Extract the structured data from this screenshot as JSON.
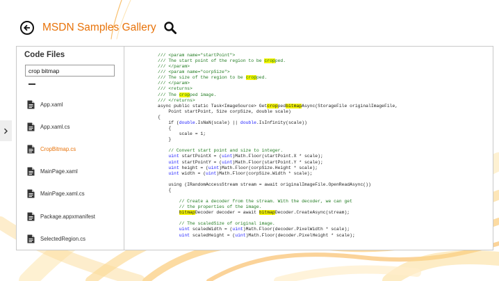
{
  "header": {
    "title": "MSDN Samples Gallery",
    "back_icon": "back-arrow-icon",
    "search_icon": "search-icon"
  },
  "sidebar": {
    "title": "Code Files",
    "search_value": "crop bitmap",
    "files": [
      {
        "name": "App.xaml",
        "selected": false
      },
      {
        "name": "App.xaml.cs",
        "selected": false
      },
      {
        "name": "CropBitmap.cs",
        "selected": true
      },
      {
        "name": "MainPage.xaml",
        "selected": false
      },
      {
        "name": "MainPage.xaml.cs",
        "selected": false
      },
      {
        "name": "Package.appxmanifest",
        "selected": false
      },
      {
        "name": "SelectedRegion.cs",
        "selected": false
      }
    ]
  },
  "colors": {
    "accent": "#e8730a",
    "highlight": "#f4f400",
    "comment": "#1f7a1f",
    "keyword": "#1a1aff"
  },
  "code": {
    "lines": [
      {
        "comment": true,
        "segments": [
          {
            "t": "/// <param name=\"startPoint\">"
          }
        ]
      },
      {
        "comment": true,
        "segments": [
          {
            "t": "/// The start point of the region to be "
          },
          {
            "t": "crop",
            "hl": true
          },
          {
            "t": "ped."
          }
        ]
      },
      {
        "comment": true,
        "segments": [
          {
            "t": "/// </param>"
          }
        ]
      },
      {
        "comment": true,
        "segments": [
          {
            "t": "/// <param name=\"corpSize\">"
          }
        ]
      },
      {
        "comment": true,
        "segments": [
          {
            "t": "/// The size of the region to be "
          },
          {
            "t": "crop",
            "hl": true
          },
          {
            "t": "ped."
          }
        ]
      },
      {
        "comment": true,
        "segments": [
          {
            "t": "/// </param>"
          }
        ]
      },
      {
        "comment": true,
        "segments": [
          {
            "t": "/// <returns>"
          }
        ]
      },
      {
        "comment": true,
        "segments": [
          {
            "t": "/// The "
          },
          {
            "t": "crop",
            "hl": true
          },
          {
            "t": "ped image."
          }
        ]
      },
      {
        "comment": true,
        "segments": [
          {
            "t": "/// </returns>"
          }
        ]
      },
      {
        "segments": [
          {
            "t": "async public static Task<ImageSource> Get"
          },
          {
            "t": "crop",
            "hl": true
          },
          {
            "t": "ped"
          },
          {
            "t": "bitmap",
            "hl": true
          },
          {
            "t": "Async(StorageFile originalImageFile,"
          }
        ]
      },
      {
        "segments": [
          {
            "t": "    Point startPoint, Size corpSize, double scale)"
          }
        ]
      },
      {
        "segments": [
          {
            "t": "{"
          }
        ]
      },
      {
        "segments": [
          {
            "t": "    if ("
          },
          {
            "t": "double",
            "kw": true
          },
          {
            "t": ".IsNaN(scale) || "
          },
          {
            "t": "double",
            "kw": true
          },
          {
            "t": ".IsInfinity(scale))"
          }
        ]
      },
      {
        "segments": [
          {
            "t": "    {"
          }
        ]
      },
      {
        "segments": [
          {
            "t": "        scale = 1;"
          }
        ]
      },
      {
        "segments": [
          {
            "t": "    }"
          }
        ]
      },
      {
        "segments": [
          {
            "t": ""
          }
        ]
      },
      {
        "comment": true,
        "segments": [
          {
            "t": "    // Convert start point and size to integer."
          }
        ]
      },
      {
        "segments": [
          {
            "t": "    "
          },
          {
            "t": "uint",
            "kw": true
          },
          {
            "t": " startPointX = ("
          },
          {
            "t": "uint",
            "kw": true
          },
          {
            "t": ")Math.Floor(startPoint.X * scale);"
          }
        ]
      },
      {
        "segments": [
          {
            "t": "    "
          },
          {
            "t": "uint",
            "kw": true
          },
          {
            "t": " startPointY = ("
          },
          {
            "t": "uint",
            "kw": true
          },
          {
            "t": ")Math.Floor(startPoint.Y * scale);"
          }
        ]
      },
      {
        "segments": [
          {
            "t": "    "
          },
          {
            "t": "uint",
            "kw": true
          },
          {
            "t": " height = ("
          },
          {
            "t": "uint",
            "kw": true
          },
          {
            "t": ")Math.Floor(corpSize.Height * scale);"
          }
        ]
      },
      {
        "segments": [
          {
            "t": "    "
          },
          {
            "t": "uint",
            "kw": true
          },
          {
            "t": " width = ("
          },
          {
            "t": "uint",
            "kw": true
          },
          {
            "t": ")Math.Floor(corpSize.Width * scale);"
          }
        ]
      },
      {
        "segments": [
          {
            "t": ""
          }
        ]
      },
      {
        "segments": [
          {
            "t": "    using (IRandomAccessStream stream = await originalImageFile.OpenReadAsync())"
          }
        ]
      },
      {
        "segments": [
          {
            "t": "    {"
          }
        ]
      },
      {
        "segments": [
          {
            "t": ""
          }
        ]
      },
      {
        "comment": true,
        "segments": [
          {
            "t": "        // Create a decoder from the stream. With the decoder, we can get"
          }
        ]
      },
      {
        "comment": true,
        "segments": [
          {
            "t": "        // the properties of the image."
          }
        ]
      },
      {
        "segments": [
          {
            "t": "        "
          },
          {
            "t": "bitmap",
            "hl": true
          },
          {
            "t": "Decoder decoder = await "
          },
          {
            "t": "bitmap",
            "hl": true
          },
          {
            "t": "Decoder.CreateAsync(stream);"
          }
        ]
      },
      {
        "segments": [
          {
            "t": ""
          }
        ]
      },
      {
        "comment": true,
        "segments": [
          {
            "t": "        // The scaledSize of original image."
          }
        ]
      },
      {
        "segments": [
          {
            "t": "        "
          },
          {
            "t": "uint",
            "kw": true
          },
          {
            "t": " scaledWidth = ("
          },
          {
            "t": "uint",
            "kw": true
          },
          {
            "t": ")Math.Floor(decoder.PixelWidth * scale);"
          }
        ]
      },
      {
        "segments": [
          {
            "t": "        "
          },
          {
            "t": "uint",
            "kw": true
          },
          {
            "t": " scaledHeight = ("
          },
          {
            "t": "uint",
            "kw": true
          },
          {
            "t": ")Math.Floor(decoder.PixelHeight * scale);"
          }
        ]
      }
    ]
  }
}
